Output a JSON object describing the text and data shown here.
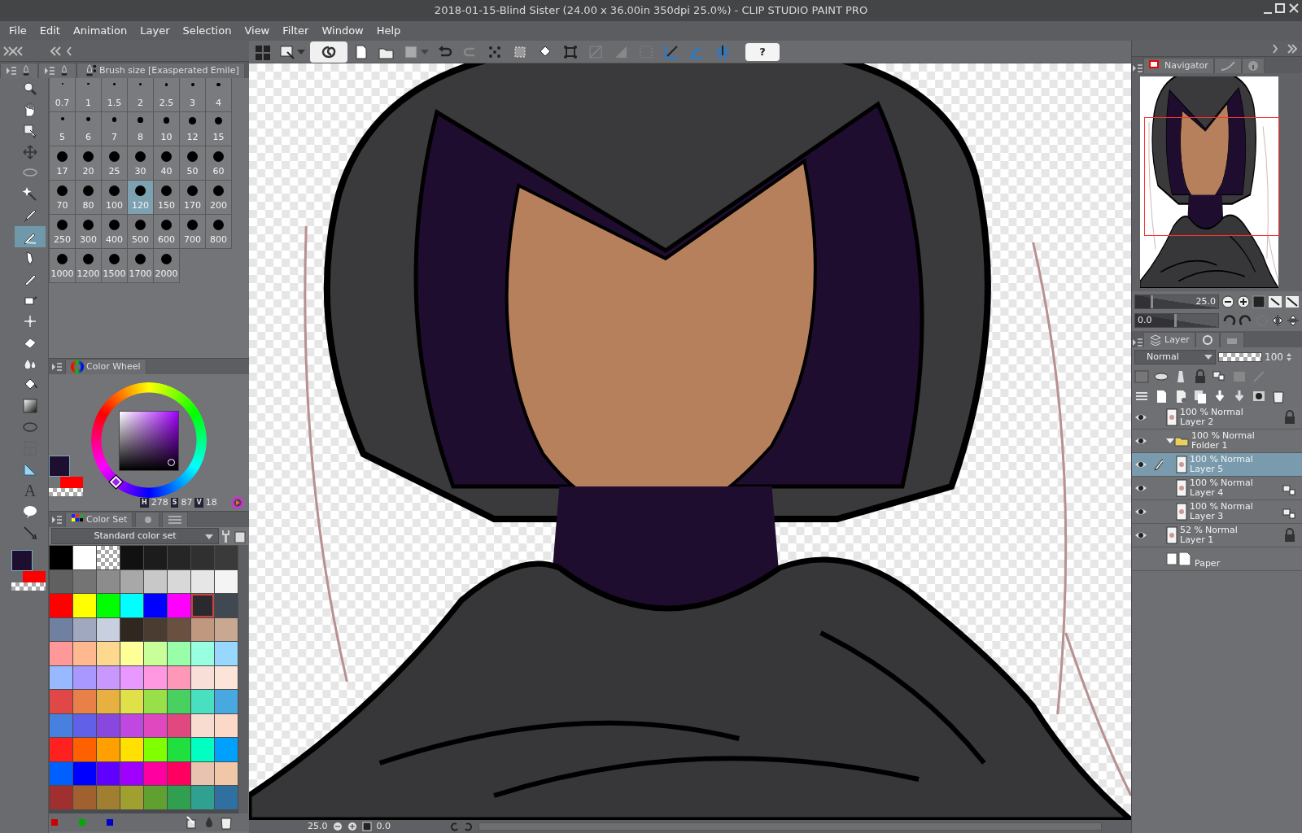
{
  "window": {
    "title": "2018-01-15-Blind Sister (24.00 x 36.00in 350dpi 25.0%)  - CLIP STUDIO PAINT PRO"
  },
  "menu": [
    "File",
    "Edit",
    "Animation",
    "Layer",
    "Selection",
    "View",
    "Filter",
    "Window",
    "Help"
  ],
  "toolbar": {
    "help": "?",
    "snap_toggles": [
      {
        "on": true
      },
      {
        "on": true
      },
      {
        "on": true
      }
    ]
  },
  "tools": [
    {
      "kind": "zoom",
      "selected": false
    },
    {
      "kind": "hand",
      "selected": false
    },
    {
      "kind": "operation",
      "selected": false
    },
    {
      "kind": "move",
      "selected": false
    },
    {
      "kind": "lasso",
      "selected": false
    },
    {
      "kind": "wand",
      "selected": false
    },
    {
      "kind": "eyedropper",
      "selected": false
    },
    {
      "kind": "pen",
      "selected": true
    },
    {
      "kind": "pencil",
      "selected": false
    },
    {
      "kind": "brush",
      "selected": false
    },
    {
      "kind": "airbrush",
      "selected": false
    },
    {
      "kind": "decoration",
      "selected": false
    },
    {
      "kind": "eraser",
      "selected": false
    },
    {
      "kind": "blend",
      "selected": false
    },
    {
      "kind": "fill",
      "selected": false
    },
    {
      "kind": "gradient",
      "selected": false
    },
    {
      "kind": "figure",
      "selected": false
    },
    {
      "kind": "frame",
      "selected": false
    },
    {
      "kind": "ruler",
      "selected": false
    },
    {
      "kind": "text",
      "glyph": "A",
      "selected": false
    },
    {
      "kind": "balloon",
      "selected": false
    },
    {
      "kind": "correction",
      "selected": false
    }
  ],
  "tool_colors": [
    {
      "kind": "main",
      "color": "#1e0e30"
    },
    {
      "kind": "sub",
      "color": "#ff0000"
    }
  ],
  "brush_size": {
    "title": "Brush size [Exasperated Emile]",
    "sizes": [
      {
        "label": "0.7",
        "selected": false
      },
      {
        "label": "1",
        "selected": false
      },
      {
        "label": "1.5",
        "selected": false
      },
      {
        "label": "2",
        "selected": false
      },
      {
        "label": "2.5",
        "selected": false
      },
      {
        "label": "3",
        "selected": false
      },
      {
        "label": "4",
        "selected": false
      },
      {
        "label": "5",
        "selected": false
      },
      {
        "label": "6",
        "selected": false
      },
      {
        "label": "7",
        "selected": false
      },
      {
        "label": "8",
        "selected": false
      },
      {
        "label": "10",
        "selected": false
      },
      {
        "label": "12",
        "selected": false
      },
      {
        "label": "15",
        "selected": false
      },
      {
        "label": "17",
        "selected": false
      },
      {
        "label": "20",
        "selected": false
      },
      {
        "label": "25",
        "selected": false
      },
      {
        "label": "30",
        "selected": false
      },
      {
        "label": "40",
        "selected": false
      },
      {
        "label": "50",
        "selected": false
      },
      {
        "label": "60",
        "selected": false
      },
      {
        "label": "70",
        "selected": false
      },
      {
        "label": "80",
        "selected": false
      },
      {
        "label": "100",
        "selected": false
      },
      {
        "label": "120",
        "selected": true
      },
      {
        "label": "150",
        "selected": false
      },
      {
        "label": "170",
        "selected": false
      },
      {
        "label": "200",
        "selected": false
      },
      {
        "label": "250",
        "selected": false
      },
      {
        "label": "300",
        "selected": false
      },
      {
        "label": "400",
        "selected": false
      },
      {
        "label": "500",
        "selected": false
      },
      {
        "label": "600",
        "selected": false
      },
      {
        "label": "700",
        "selected": false
      },
      {
        "label": "800",
        "selected": false
      },
      {
        "label": "1000",
        "selected": false
      },
      {
        "label": "1200",
        "selected": false
      },
      {
        "label": "1500",
        "selected": false
      },
      {
        "label": "1700",
        "selected": false
      },
      {
        "label": "2000",
        "selected": false
      }
    ]
  },
  "color_wheel": {
    "title": "Color Wheel",
    "colors": [
      {
        "kind": "main",
        "color": "#1e0e30"
      },
      {
        "kind": "sub",
        "color": "#ff0000"
      }
    ],
    "h_label": "H",
    "h": "278",
    "s_label": "S",
    "s": "87",
    "v_label": "V",
    "v": "18"
  },
  "color_set": {
    "title": "Color Set",
    "set_name": "Standard color set",
    "swatches": [
      {
        "color": "#000000",
        "selected": false
      },
      {
        "color": "#ffffff",
        "selected": false
      },
      {
        "kind": "transparent",
        "selected": false
      },
      {
        "color": "#111111",
        "selected": false
      },
      {
        "color": "#1c1c1c",
        "selected": false
      },
      {
        "color": "#262626",
        "selected": false
      },
      {
        "color": "#303030",
        "selected": false
      },
      {
        "color": "#3a3a3a",
        "selected": false
      },
      {
        "color": "#606060",
        "selected": false
      },
      {
        "color": "#747474",
        "selected": false
      },
      {
        "color": "#8c8c8c",
        "selected": false
      },
      {
        "color": "#a8a8a8",
        "selected": false
      },
      {
        "color": "#c8c8c8",
        "selected": false
      },
      {
        "color": "#d8d8d8",
        "selected": false
      },
      {
        "color": "#e6e6e6",
        "selected": false
      },
      {
        "color": "#f4f4f4",
        "selected": false
      },
      {
        "color": "#ff0000",
        "selected": false
      },
      {
        "color": "#ffff00",
        "selected": false
      },
      {
        "color": "#00ff00",
        "selected": false
      },
      {
        "color": "#00ffff",
        "selected": false
      },
      {
        "color": "#0000ff",
        "selected": false
      },
      {
        "color": "#ff00ff",
        "selected": false
      },
      {
        "color": "#2a2a2e",
        "selected": true
      },
      {
        "color": "#404852",
        "selected": false
      },
      {
        "color": "#7080a0",
        "selected": false
      },
      {
        "color": "#a0a8c0",
        "selected": false
      },
      {
        "color": "#c8d0e0",
        "selected": false
      },
      {
        "color": "#302820",
        "selected": false
      },
      {
        "color": "#4a3c30",
        "selected": false
      },
      {
        "color": "#6a5040",
        "selected": false
      },
      {
        "color": "#c09880",
        "selected": false
      },
      {
        "color": "#c8a890",
        "selected": false
      },
      {
        "color": "#ff9898",
        "selected": false
      },
      {
        "color": "#ffb890",
        "selected": false
      },
      {
        "color": "#ffd890",
        "selected": false
      },
      {
        "color": "#ffff98",
        "selected": false
      },
      {
        "color": "#c8ff98",
        "selected": false
      },
      {
        "color": "#98ffa8",
        "selected": false
      },
      {
        "color": "#98ffe0",
        "selected": false
      },
      {
        "color": "#98d8ff",
        "selected": false
      },
      {
        "color": "#98b8ff",
        "selected": false
      },
      {
        "color": "#a898ff",
        "selected": false
      },
      {
        "color": "#c898ff",
        "selected": false
      },
      {
        "color": "#e898ff",
        "selected": false
      },
      {
        "color": "#ff98e0",
        "selected": false
      },
      {
        "color": "#ff98b8",
        "selected": false
      },
      {
        "color": "#f8e0d8",
        "selected": false
      },
      {
        "color": "#fce4d8",
        "selected": false
      },
      {
        "color": "#e04848",
        "selected": false
      },
      {
        "color": "#e88048",
        "selected": false
      },
      {
        "color": "#e8b040",
        "selected": false
      },
      {
        "color": "#e0e048",
        "selected": false
      },
      {
        "color": "#98e048",
        "selected": false
      },
      {
        "color": "#48d060",
        "selected": false
      },
      {
        "color": "#48e0c0",
        "selected": false
      },
      {
        "color": "#48a8e0",
        "selected": false
      },
      {
        "color": "#4880e0",
        "selected": false
      },
      {
        "color": "#6060e8",
        "selected": false
      },
      {
        "color": "#8848e0",
        "selected": false
      },
      {
        "color": "#c048e0",
        "selected": false
      },
      {
        "color": "#e048c0",
        "selected": false
      },
      {
        "color": "#e04880",
        "selected": false
      },
      {
        "color": "#f8dcd0",
        "selected": false
      },
      {
        "color": "#fcd8c8",
        "selected": false
      },
      {
        "color": "#ff2020",
        "selected": false
      },
      {
        "color": "#ff6000",
        "selected": false
      },
      {
        "color": "#ffa000",
        "selected": false
      },
      {
        "color": "#ffe000",
        "selected": false
      },
      {
        "color": "#80ff00",
        "selected": false
      },
      {
        "color": "#20e040",
        "selected": false
      },
      {
        "color": "#00ffc0",
        "selected": false
      },
      {
        "color": "#00a0ff",
        "selected": false
      },
      {
        "color": "#0060ff",
        "selected": false
      },
      {
        "color": "#0000ff",
        "selected": false
      },
      {
        "color": "#6000ff",
        "selected": false
      },
      {
        "color": "#a000ff",
        "selected": false
      },
      {
        "color": "#ff00a0",
        "selected": false
      },
      {
        "color": "#ff0060",
        "selected": false
      },
      {
        "color": "#e8c4b0",
        "selected": false
      },
      {
        "color": "#f0c8a8",
        "selected": false
      },
      {
        "color": "#a03030",
        "selected": false
      },
      {
        "color": "#a06030",
        "selected": false
      },
      {
        "color": "#a08030",
        "selected": false
      },
      {
        "color": "#a0a030",
        "selected": false
      },
      {
        "color": "#60a030",
        "selected": false
      },
      {
        "color": "#30a050",
        "selected": false
      },
      {
        "color": "#30a090",
        "selected": false
      },
      {
        "color": "#3070a0",
        "selected": false
      }
    ]
  },
  "status_bar": {
    "zoom": "25.0",
    "rotation": "0.0"
  },
  "navigator": {
    "title": "Navigator",
    "zoom": "25.0",
    "zoom_slider": {
      "level": 0.22
    },
    "rotation": "0.0",
    "rotation_slider": {
      "level": 0.5
    }
  },
  "layer_panel": {
    "title": "Layer",
    "blend_mode": "Normal",
    "opacity_slider": {
      "level": 1
    },
    "opacity": "100",
    "layers": [
      {
        "kind": "raster",
        "opacity": "100 %",
        "blend": "Normal",
        "name": "Layer 2",
        "visible": true,
        "locked": true,
        "selected": false
      },
      {
        "kind": "folder",
        "opacity": "100 %",
        "blend": "Normal",
        "name": "Folder 1",
        "visible": true,
        "expanded": true,
        "selected": false,
        "children": [
          {
            "kind": "raster",
            "opacity": "100 %",
            "blend": "Normal",
            "name": "Layer 5",
            "visible": true,
            "drawing": true,
            "selected": true
          },
          {
            "kind": "raster",
            "opacity": "100 %",
            "blend": "Normal",
            "name": "Layer 4",
            "visible": true,
            "alpha_locked": true,
            "selected": false
          },
          {
            "kind": "raster",
            "opacity": "100 %",
            "blend": "Normal",
            "name": "Layer 3",
            "visible": true,
            "alpha_locked": true,
            "selected": false
          }
        ]
      },
      {
        "kind": "raster",
        "opacity": "52 %",
        "blend": "Normal",
        "name": "Layer 1",
        "visible": true,
        "locked": true,
        "selected": false
      },
      {
        "kind": "paper",
        "name": "Paper",
        "visible": false,
        "selected": false
      }
    ]
  }
}
